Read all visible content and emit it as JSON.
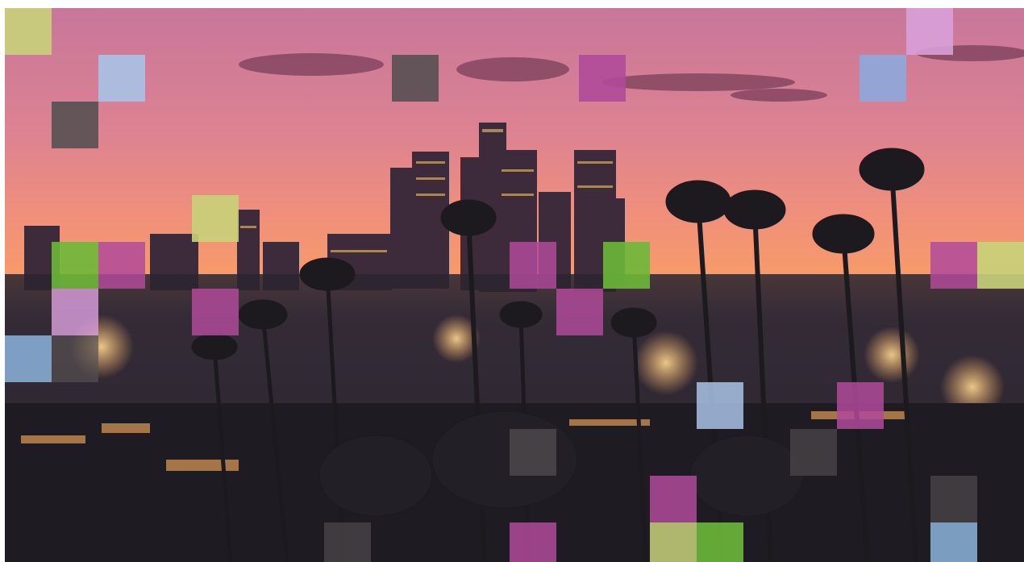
{
  "image": {
    "subject": "photo",
    "palette": {
      "sky_top": "#c8779a",
      "sky_mid": "#e48a86",
      "sky_horizon": "#f79a6a",
      "cloud": "#7a3f58",
      "skyline_dark": "#3d2a3a",
      "city_night": "#2a2630",
      "city_lights": "#ffd27a",
      "palm_silhouette": "#1c1a1e"
    }
  },
  "overlay_tiles": [
    {
      "color": "#c8d27a",
      "opacity": 0.9
    },
    {
      "color": "#a9c2e6",
      "opacity": 0.9
    },
    {
      "color": "#555052",
      "opacity": 0.9
    },
    {
      "color": "#555052",
      "opacity": 0.9
    },
    {
      "color": "#b04a9a",
      "opacity": 0.9
    },
    {
      "color": "#d8a0d8",
      "opacity": 0.9
    },
    {
      "color": "#8ca8dc",
      "opacity": 0.9
    },
    {
      "color": "#c8d27a",
      "opacity": 0.9
    },
    {
      "color": "#6cb83a",
      "opacity": 0.9
    },
    {
      "color": "#b04a9a",
      "opacity": 0.85
    },
    {
      "color": "#d39ad6",
      "opacity": 0.85
    },
    {
      "color": "#b04a9a",
      "opacity": 0.85
    },
    {
      "color": "#8cb4dc",
      "opacity": 0.85
    },
    {
      "color": "#555052",
      "opacity": 0.7
    },
    {
      "color": "#b04a9a",
      "opacity": 0.85
    },
    {
      "color": "#b04a9a",
      "opacity": 0.85
    },
    {
      "color": "#6cb83a",
      "opacity": 0.9
    },
    {
      "color": "#b04a9a",
      "opacity": 0.85
    },
    {
      "color": "#c8d27a",
      "opacity": 0.9
    },
    {
      "color": "#a9c2e6",
      "opacity": 0.85
    },
    {
      "color": "#b04a9a",
      "opacity": 0.85
    },
    {
      "color": "#555052",
      "opacity": 0.7
    },
    {
      "color": "#555052",
      "opacity": 0.6
    },
    {
      "color": "#b04a9a",
      "opacity": 0.85
    },
    {
      "color": "#c8d27a",
      "opacity": 0.85
    },
    {
      "color": "#6cb83a",
      "opacity": 0.9
    },
    {
      "color": "#b04a9a",
      "opacity": 0.85
    },
    {
      "color": "#555052",
      "opacity": 0.6
    },
    {
      "color": "#8cb4dc",
      "opacity": 0.85
    },
    {
      "color": "#555052",
      "opacity": 0.6
    }
  ]
}
